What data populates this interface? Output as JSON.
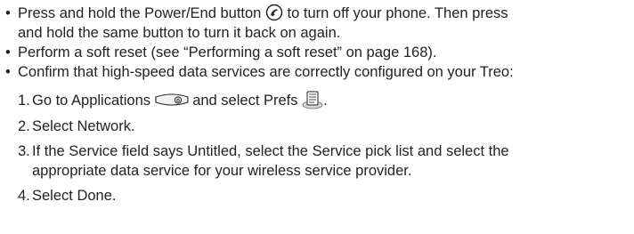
{
  "bullets": [
    {
      "glyph": "•",
      "line1_before_icon": "Press and hold the Power/End button",
      "line1_after_icon": "to turn off your phone. Then press",
      "line2": "and hold the same button to turn it back on again.",
      "icon": "power-end-button-icon"
    },
    {
      "glyph": "•",
      "text": "Perform a soft reset (see “Performing a soft reset” on page 168)."
    },
    {
      "glyph": "•",
      "text": "Confirm that high-speed data services are correctly configured on your Treo:"
    }
  ],
  "steps": [
    {
      "num": "1.",
      "before_icon1": "Go to Applications",
      "middle": "and select Prefs",
      "after_icon2": ".",
      "icon1": "applications-icon",
      "icon2": "prefs-icon"
    },
    {
      "num": "2.",
      "text": "Select Network."
    },
    {
      "num": "3.",
      "line1": "If the Service field says Untitled, select the Service pick list and select the",
      "line2": "appropriate data service for your wireless service provider."
    },
    {
      "num": "4.",
      "text": "Select Done."
    }
  ]
}
